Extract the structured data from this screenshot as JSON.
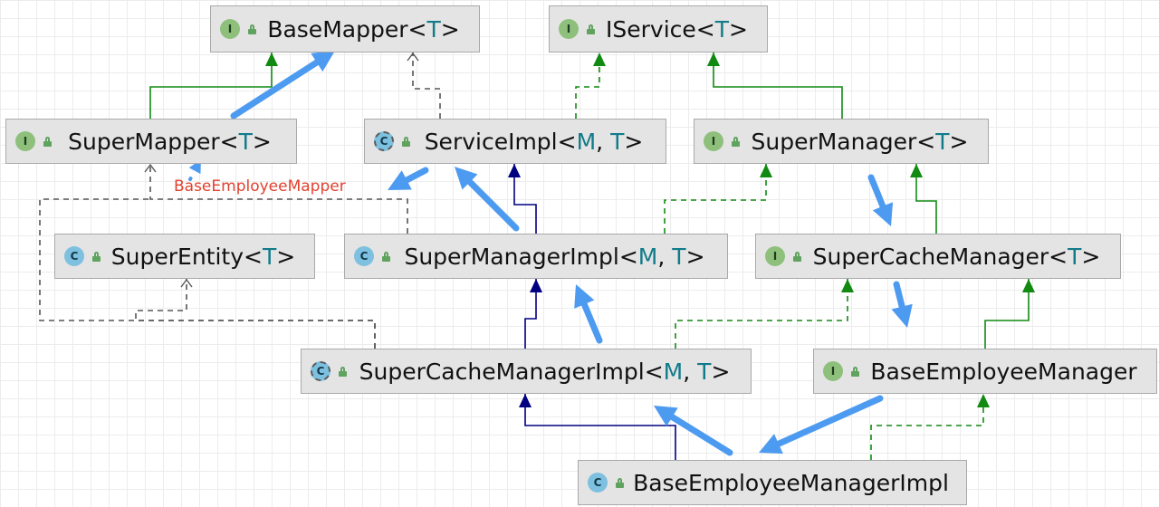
{
  "nodes": [
    {
      "id": "base-mapper",
      "kind": "interface",
      "badge": "I",
      "name": "BaseMapper<",
      "params": [
        "T"
      ],
      "close": ">"
    },
    {
      "id": "iservice",
      "kind": "interface",
      "badge": "I",
      "name": "IService<",
      "params": [
        "T"
      ],
      "close": ">"
    },
    {
      "id": "super-mapper",
      "kind": "interface",
      "badge": "I",
      "name": "SuperMapper<",
      "params": [
        "T"
      ],
      "close": ">"
    },
    {
      "id": "service-impl",
      "kind": "abstract",
      "badge": "C",
      "name": "ServiceImpl<",
      "params": [
        "M",
        "T"
      ],
      "close": ">"
    },
    {
      "id": "super-manager",
      "kind": "interface",
      "badge": "I",
      "name": "SuperManager<",
      "params": [
        "T"
      ],
      "close": ">"
    },
    {
      "id": "super-entity",
      "kind": "class",
      "badge": "C",
      "name": "SuperEntity<",
      "params": [
        "T"
      ],
      "close": ">"
    },
    {
      "id": "super-manager-impl",
      "kind": "class",
      "badge": "C",
      "name": "SuperManagerImpl<",
      "params": [
        "M",
        "T"
      ],
      "close": ">"
    },
    {
      "id": "super-cache-manager",
      "kind": "interface",
      "badge": "I",
      "name": "SuperCacheManager<",
      "params": [
        "T"
      ],
      "close": ">"
    },
    {
      "id": "super-cache-manager-impl",
      "kind": "abstract",
      "badge": "C",
      "name": "SuperCacheManagerImpl<",
      "params": [
        "M",
        "T"
      ],
      "close": ">"
    },
    {
      "id": "base-employee-manager",
      "kind": "interface",
      "badge": "I",
      "name": "BaseEmployeeManager",
      "params": [],
      "close": ""
    },
    {
      "id": "base-employee-manager-impl",
      "kind": "class",
      "badge": "C",
      "name": "BaseEmployeeManagerImpl",
      "params": [],
      "close": ""
    }
  ],
  "edges": [
    {
      "from": "super-mapper",
      "to": "base-mapper",
      "type": "extends-interface"
    },
    {
      "from": "service-impl",
      "to": "base-mapper",
      "type": "dependency"
    },
    {
      "from": "service-impl",
      "to": "iservice",
      "type": "implements"
    },
    {
      "from": "super-manager",
      "to": "iservice",
      "type": "extends-interface"
    },
    {
      "from": "super-manager-impl",
      "to": "service-impl",
      "type": "extends-class"
    },
    {
      "from": "super-manager-impl",
      "to": "super-manager",
      "type": "implements"
    },
    {
      "from": "super-manager-impl",
      "to": "super-mapper",
      "type": "dependency"
    },
    {
      "from": "super-cache-manager",
      "to": "super-manager",
      "type": "extends-interface"
    },
    {
      "from": "super-cache-manager-impl",
      "to": "super-manager-impl",
      "type": "extends-class"
    },
    {
      "from": "super-cache-manager-impl",
      "to": "super-cache-manager",
      "type": "implements"
    },
    {
      "from": "super-cache-manager-impl",
      "to": "super-mapper",
      "type": "dependency"
    },
    {
      "from": "super-cache-manager-impl",
      "to": "super-entity",
      "type": "dependency"
    },
    {
      "from": "base-employee-manager",
      "to": "super-cache-manager",
      "type": "extends-interface"
    },
    {
      "from": "base-employee-manager-impl",
      "to": "super-cache-manager-impl",
      "type": "extends-class"
    },
    {
      "from": "base-employee-manager-impl",
      "to": "base-employee-manager",
      "type": "implements"
    }
  ],
  "annotation": "BaseEmployeeMapper",
  "colors": {
    "extends_class": "#000080",
    "implements": "#108a10",
    "dependency": "#555555",
    "highlight": "#4d9bf0",
    "annotation": "#e2412f",
    "type_param": "#127b8a"
  }
}
